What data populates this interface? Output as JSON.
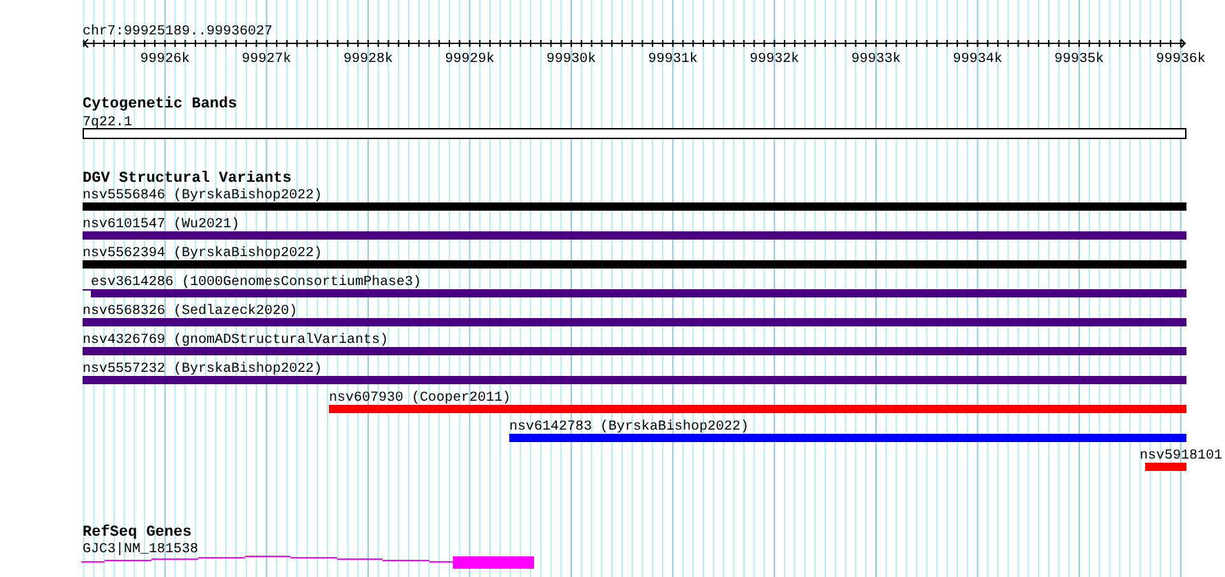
{
  "ruler": {
    "location": "chr7:99925189..99936027",
    "tick_labels": [
      "99926k",
      "99927k",
      "99928k",
      "99929k",
      "99930k",
      "99931k",
      "99932k",
      "99933k",
      "99934k",
      "99935k",
      "99936k"
    ]
  },
  "tracks": [
    {
      "kind": "cytoband",
      "title": "Cytogenetic Bands",
      "features": [
        {
          "label": "7q22.1"
        }
      ]
    },
    {
      "kind": "variants",
      "title": "DGV Structural Variants",
      "features": [
        {
          "label": "nsv5556846 (ByrskaBishop2022)",
          "color": "#000000"
        },
        {
          "label": "nsv6101547 (Wu2021)",
          "color": "#4b0082"
        },
        {
          "label": "nsv5562394 (ByrskaBishop2022)",
          "color": "#000000"
        },
        {
          "label": "esv3614286 (1000GenomesConsortiumPhase3)",
          "color": "#4b0082"
        },
        {
          "label": "nsv6568326 (Sedlazeck2020)",
          "color": "#4b0082"
        },
        {
          "label": "nsv4326769 (gnomADStructuralVariants)",
          "color": "#4b0082"
        },
        {
          "label": "nsv5557232 (ByrskaBishop2022)",
          "color": "#4b0082"
        },
        {
          "label": "nsv607930 (Cooper2011)",
          "color": "#ff0000"
        },
        {
          "label": "nsv6142783 (ByrskaBishop2022)",
          "color": "#0000ff"
        },
        {
          "label": "nsv5918101",
          "color": "#ff0000"
        }
      ]
    },
    {
      "kind": "genes",
      "title": "RefSeq Genes",
      "features": [
        {
          "label": "GJC3|NM_181538"
        }
      ]
    }
  ]
}
